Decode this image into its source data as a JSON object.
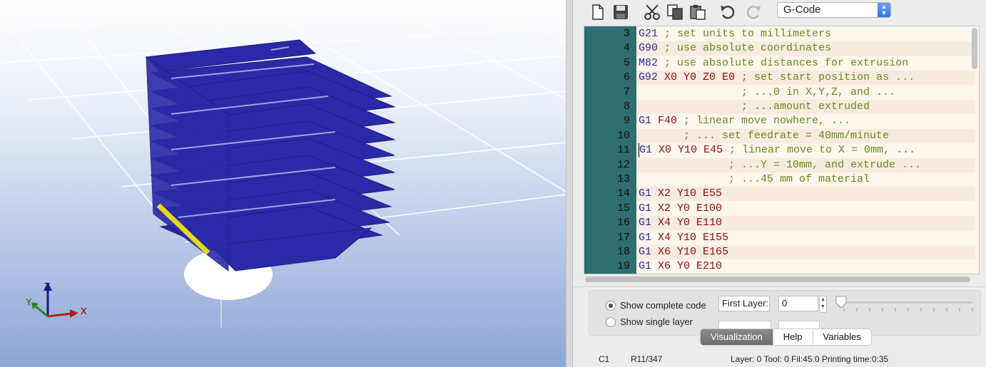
{
  "viewport": {
    "axes": {
      "x_label": "X",
      "y_label": "Y",
      "z_label": "Z"
    }
  },
  "toolbar": {
    "buttons": [
      "new-file-icon",
      "save-icon",
      "cut-icon",
      "copy-icon",
      "paste-icon",
      "undo-icon",
      "redo-icon"
    ],
    "mode_select": "G-Code"
  },
  "editor": {
    "lines": [
      {
        "num": "3",
        "cmd": "G21",
        "rest": "",
        "comment": "; set units to millimeters"
      },
      {
        "num": "4",
        "cmd": "G90",
        "rest": "",
        "comment": "; use absolute coordinates"
      },
      {
        "num": "5",
        "cmd": "M82",
        "rest": "",
        "comment": "; use absolute distances for extrusion"
      },
      {
        "num": "6",
        "cmd": "G92",
        "rest": "X0 Y0 Z0 E0",
        "comment": "; set start position as ..."
      },
      {
        "num": "7",
        "cmd": "",
        "rest": "",
        "comment": "                ; ...0 in X,Y,Z, and ..."
      },
      {
        "num": "8",
        "cmd": "",
        "rest": "",
        "comment": "                ; ...amount extruded"
      },
      {
        "num": "9",
        "cmd": "G1",
        "rest": "F40",
        "comment": "; linear move nowhere, ..."
      },
      {
        "num": "10",
        "cmd": "",
        "rest": "",
        "comment": "       ; ... set feedrate = 40mm/minute"
      },
      {
        "num": "11",
        "cmd": "G1",
        "rest": "X0 Y10 E45",
        "comment": "; linear move to X = 0mm, ..."
      },
      {
        "num": "12",
        "cmd": "",
        "rest": "",
        "comment": "              ; ...Y = 10mm, and extrude ..."
      },
      {
        "num": "13",
        "cmd": "",
        "rest": "",
        "comment": "              ; ...45 mm of material"
      },
      {
        "num": "14",
        "cmd": "G1",
        "rest": "X2 Y10 E55",
        "comment": ""
      },
      {
        "num": "15",
        "cmd": "G1",
        "rest": "X2 Y0 E100",
        "comment": ""
      },
      {
        "num": "16",
        "cmd": "G1",
        "rest": "X4 Y0 E110",
        "comment": ""
      },
      {
        "num": "17",
        "cmd": "G1",
        "rest": "X4 Y10 E155",
        "comment": ""
      },
      {
        "num": "18",
        "cmd": "G1",
        "rest": "X6 Y10 E165",
        "comment": ""
      },
      {
        "num": "19",
        "cmd": "G1",
        "rest": "X6 Y0 E210",
        "comment": ""
      }
    ]
  },
  "controls": {
    "show_complete": "Show complete code",
    "show_single": "Show single layer",
    "first_layer_label": "First Layer:",
    "first_layer_value": "0"
  },
  "tabs": [
    "Visualization",
    "Help",
    "Variables"
  ],
  "status": {
    "col": "C1",
    "row": "R11/347",
    "info": "Layer: 0 Tool: 0 Fil:45.0 Printing time:0:35"
  },
  "colors": {
    "gutter": "#2e6e6e",
    "print": "#2a2aa8",
    "cmd": "#2a2aa0",
    "comment": "#6a8a1e"
  }
}
